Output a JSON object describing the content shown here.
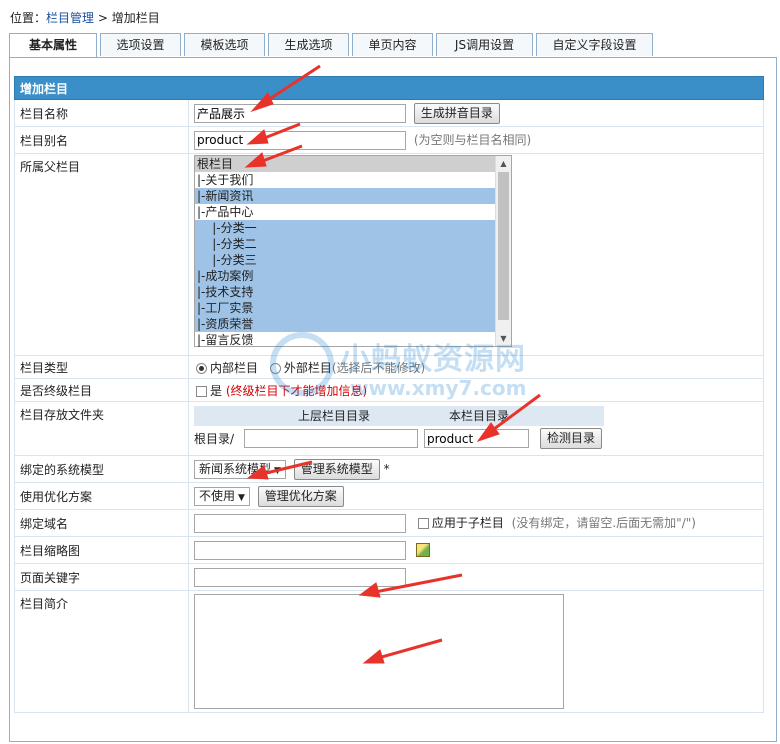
{
  "breadcrumb": {
    "prefix": "位置：",
    "link": "栏目管理",
    "sep": ">",
    "current": "增加栏目"
  },
  "tabs": [
    "基本属性",
    "选项设置",
    "模板选项",
    "生成选项",
    "单页内容",
    "JS调用设置",
    "自定义字段设置"
  ],
  "active_tab": 0,
  "form": {
    "header": "增加栏目",
    "name": {
      "label": "栏目名称",
      "value": "产品展示",
      "button": "生成拼音目录"
    },
    "alias": {
      "label": "栏目别名",
      "value": "product",
      "hint": "(为空则与栏目名相同)"
    },
    "parent": {
      "label": "所属父栏目",
      "options": [
        {
          "text": "根栏目",
          "state": "root"
        },
        {
          "text": "|-关于我们",
          "state": "normal"
        },
        {
          "text": "|-新闻资讯",
          "state": "sel"
        },
        {
          "text": "|-产品中心",
          "state": "normal"
        },
        {
          "text": "  |-分类一",
          "state": "sel"
        },
        {
          "text": "  |-分类二",
          "state": "sel"
        },
        {
          "text": "  |-分类三",
          "state": "sel"
        },
        {
          "text": "|-成功案例",
          "state": "sel"
        },
        {
          "text": "|-技术支持",
          "state": "sel"
        },
        {
          "text": "|-工厂实景",
          "state": "sel"
        },
        {
          "text": "|-资质荣誉",
          "state": "sel"
        },
        {
          "text": "|-留言反馈",
          "state": "normal"
        }
      ]
    },
    "type": {
      "label": "栏目类型",
      "opt_internal": "内部栏目",
      "opt_external": "外部栏目",
      "hint": "(选择后不能修改)"
    },
    "final": {
      "label": "是否终级栏目",
      "check_label": "是",
      "note": "(终级栏目下才能增加信息)"
    },
    "folder": {
      "label": "栏目存放文件夹",
      "col_parent": "上层栏目目录",
      "col_self": "本栏目目录",
      "root_prefix": "根目录/",
      "self_value": "product",
      "button": "检测目录"
    },
    "model": {
      "label": "绑定的系统模型",
      "selected": "新闻系统模型",
      "button": "管理系统模型",
      "mark": "*"
    },
    "optimize": {
      "label": "使用优化方案",
      "selected": "不使用",
      "button": "管理优化方案"
    },
    "domain": {
      "label": "绑定域名",
      "check_label": "应用于子栏目",
      "hint": "(没有绑定，请留空.后面无需加\"/\")"
    },
    "thumb": {
      "label": "栏目缩略图"
    },
    "keywords": {
      "label": "页面关键字"
    },
    "intro": {
      "label": "栏目简介"
    }
  },
  "watermark": {
    "text_cn": "小蚂蚁资源网",
    "text_url": "www.xmy7.com"
  },
  "colors": {
    "header_bg": "#3a8fc8",
    "selected_bg": "#9ec3e6",
    "arrow": "#e8332a",
    "note_red": "#d40000"
  },
  "icons": [
    "image-upload-icon",
    "red-annotation-arrow"
  ]
}
